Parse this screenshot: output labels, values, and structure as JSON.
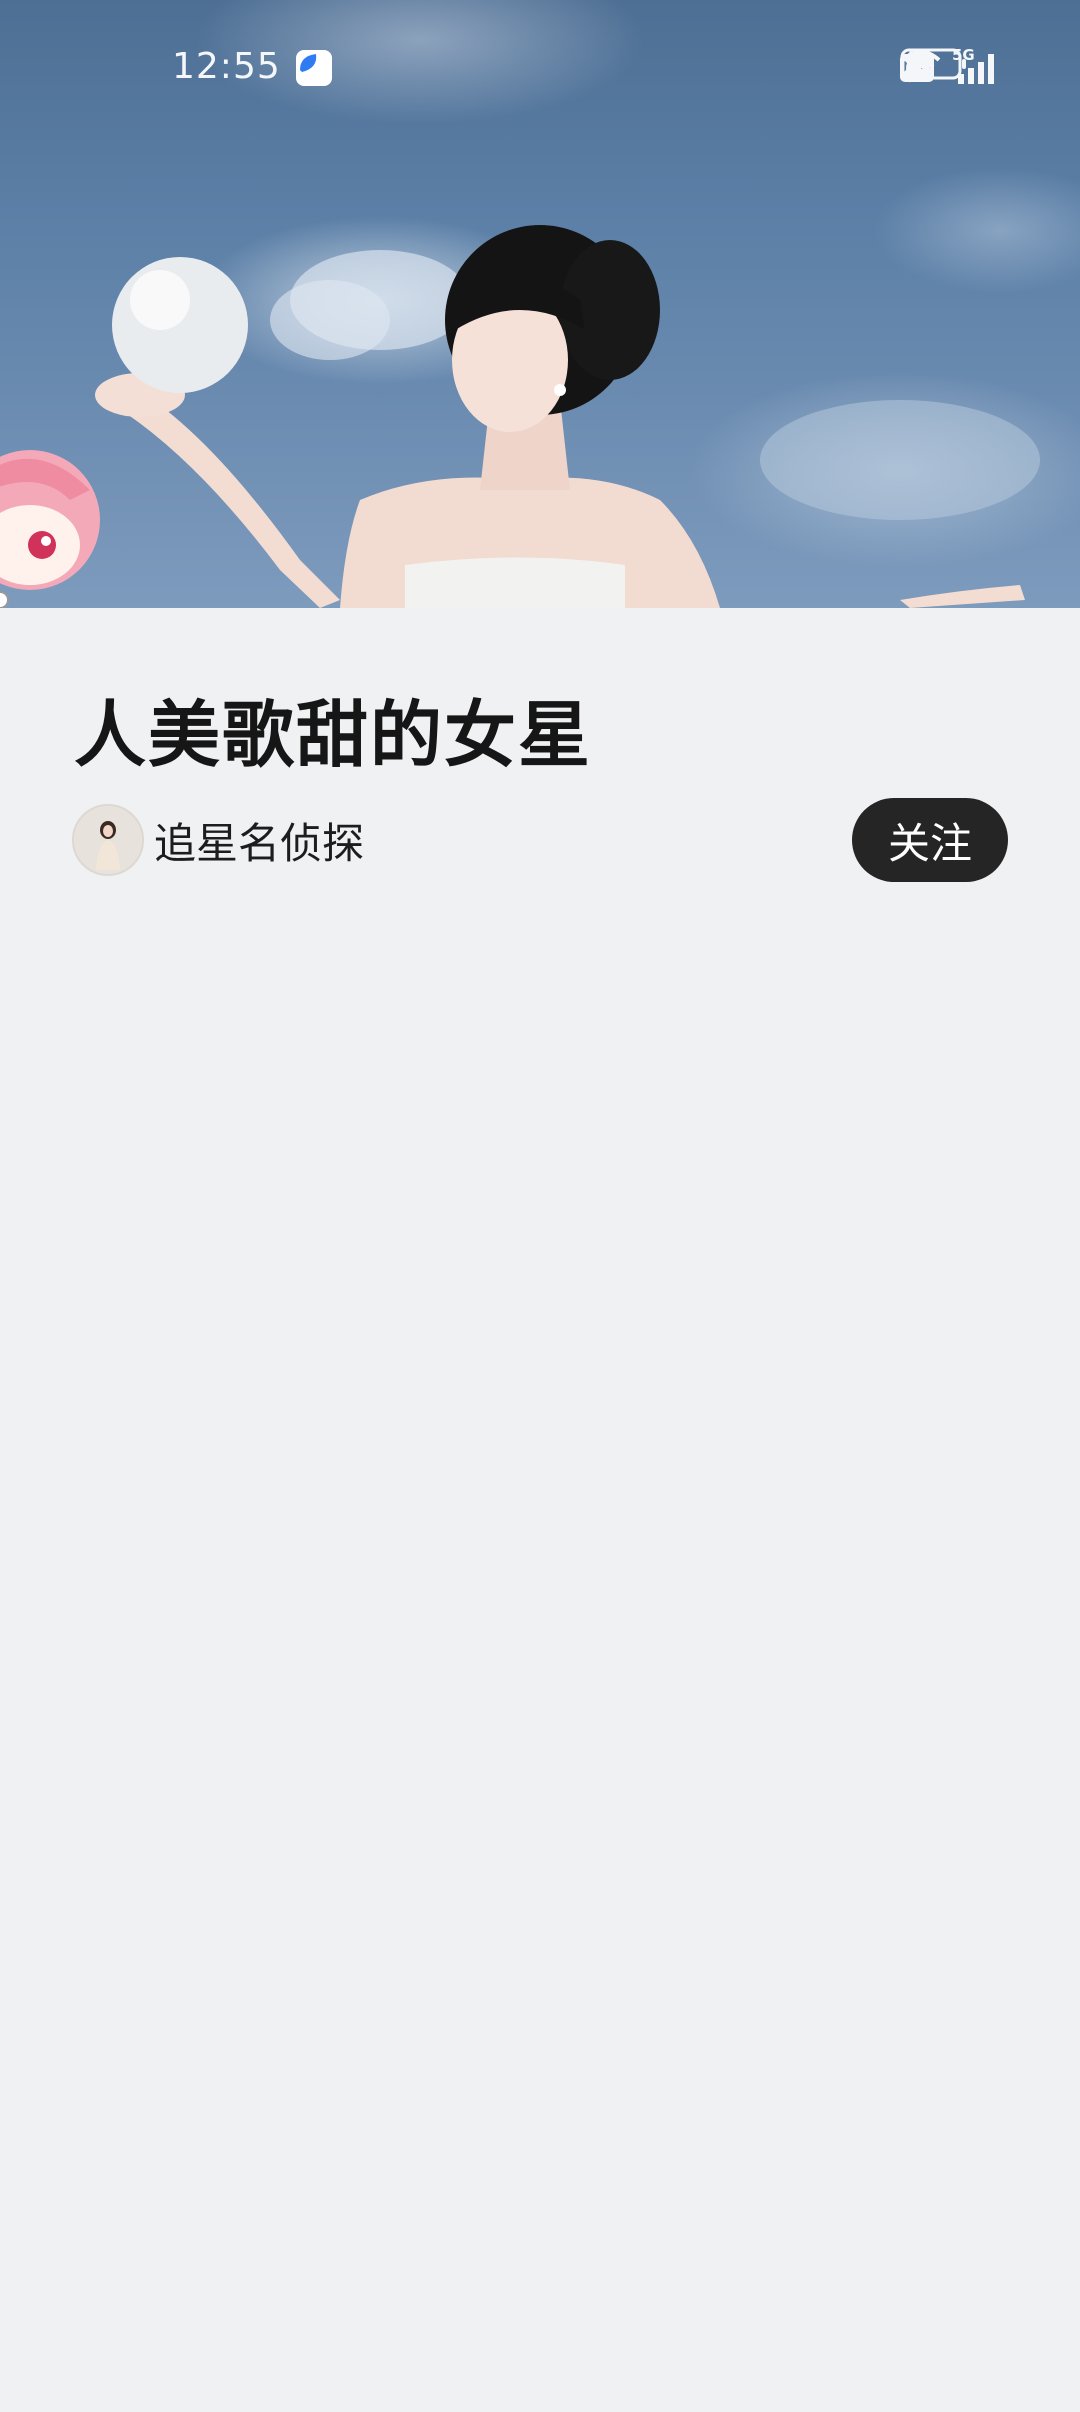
{
  "status_bar": {
    "time": "12:55",
    "icons": [
      "app-notification-icon",
      "alarm-icon",
      "bluetooth-icon",
      "hd-icon",
      "wifi-icon",
      "signal-5g-icon",
      "battery-icon"
    ],
    "hd_label": "HD",
    "network_label": "5G",
    "battery_level": 0.3
  },
  "hero": {
    "image_description_icon": "hero-photo"
  },
  "post": {
    "title": "人美歌甜的女星",
    "author_name": "追星名侦探",
    "follow_label": "关注"
  },
  "colors": {
    "background": "#f0f1f3",
    "button_bg": "#252525",
    "title_text": "#161616"
  }
}
